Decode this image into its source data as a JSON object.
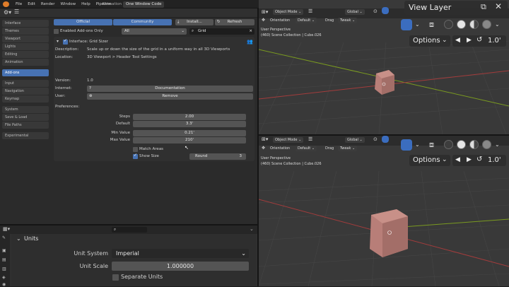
{
  "topbar": {
    "menus": [
      "File",
      "Edit",
      "Render",
      "Window",
      "Help",
      "Pipeline"
    ],
    "workspaces": [
      "Animation",
      "One Window Code"
    ],
    "active_workspace": "One Window Code"
  },
  "prefs": {
    "tabs": {
      "official": "Official",
      "community": "Community",
      "install": "Install...",
      "refresh": "Refresh"
    },
    "enabled_only": "Enabled Add-ons Only",
    "category": "All",
    "search_value": "Grid",
    "sidebar": [
      {
        "label": "Interface"
      },
      {
        "label": "Themes"
      },
      {
        "label": "Viewport"
      },
      {
        "label": "Lights"
      },
      {
        "label": "Editing"
      },
      {
        "label": "Animation"
      },
      {
        "label": "Add-ons",
        "active": true
      },
      {
        "label": "Input"
      },
      {
        "label": "Navigation"
      },
      {
        "label": "Keymap"
      },
      {
        "label": "System"
      },
      {
        "label": "Save & Load"
      },
      {
        "label": "File Paths"
      },
      {
        "label": "Experimental"
      }
    ],
    "addon": {
      "title": "Interface: Grid Sizer",
      "desc_label": "Description:",
      "desc": "Scale up or down the size of the grid in a uniform way in all 3D Viewports",
      "loc_label": "Location:",
      "loc": "3D Viewport > Header Tool Settings",
      "ver_label": "Version:",
      "ver": "1.0",
      "internet_label": "Internet:",
      "doc_btn": "Documentation",
      "user_label": "User:",
      "remove_btn": "Remove",
      "preferences_label": "Preferences:",
      "steps_label": "Steps",
      "steps": "2.00",
      "default_label": "Default",
      "default": "3.3'",
      "min_label": "Min Value",
      "min": "0.21'",
      "max_label": "Max Value",
      "max": "210'",
      "match_areas": "Match Areas",
      "show_size": "Show Size",
      "round_label": "Round",
      "round_val": "3"
    }
  },
  "props": {
    "section": "Units",
    "unit_system_label": "Unit System",
    "unit_system": "Imperial",
    "unit_scale_label": "Unit Scale",
    "unit_scale": "1.000000",
    "separate_units": "Separate Units"
  },
  "vp_top": {
    "mode": "Object Mode",
    "orientation_label": "Orientation",
    "orientation": "Default",
    "drag_label": "Drag",
    "drag": "Tweak",
    "transform": "Global",
    "persp": "User Perspective",
    "collection": "(460) Scene Collection | Cube.026",
    "view_layer": "View Layer",
    "options": "Options",
    "zoom": "1.0'"
  },
  "vp_bot": {
    "mode": "Object Mode",
    "orientation_label": "Orientation",
    "orientation": "Default",
    "drag_label": "Drag",
    "drag": "Tweak",
    "transform": "Global",
    "persp": "User Perspective",
    "collection": "(460) Scene Collection | Cube.026",
    "options": "Options",
    "zoom": "1.0'"
  },
  "colors": {
    "accent": "#4772b3",
    "cube": "#b87e78",
    "xaxis": "#a33c3c",
    "yaxis": "#7a9a20"
  }
}
